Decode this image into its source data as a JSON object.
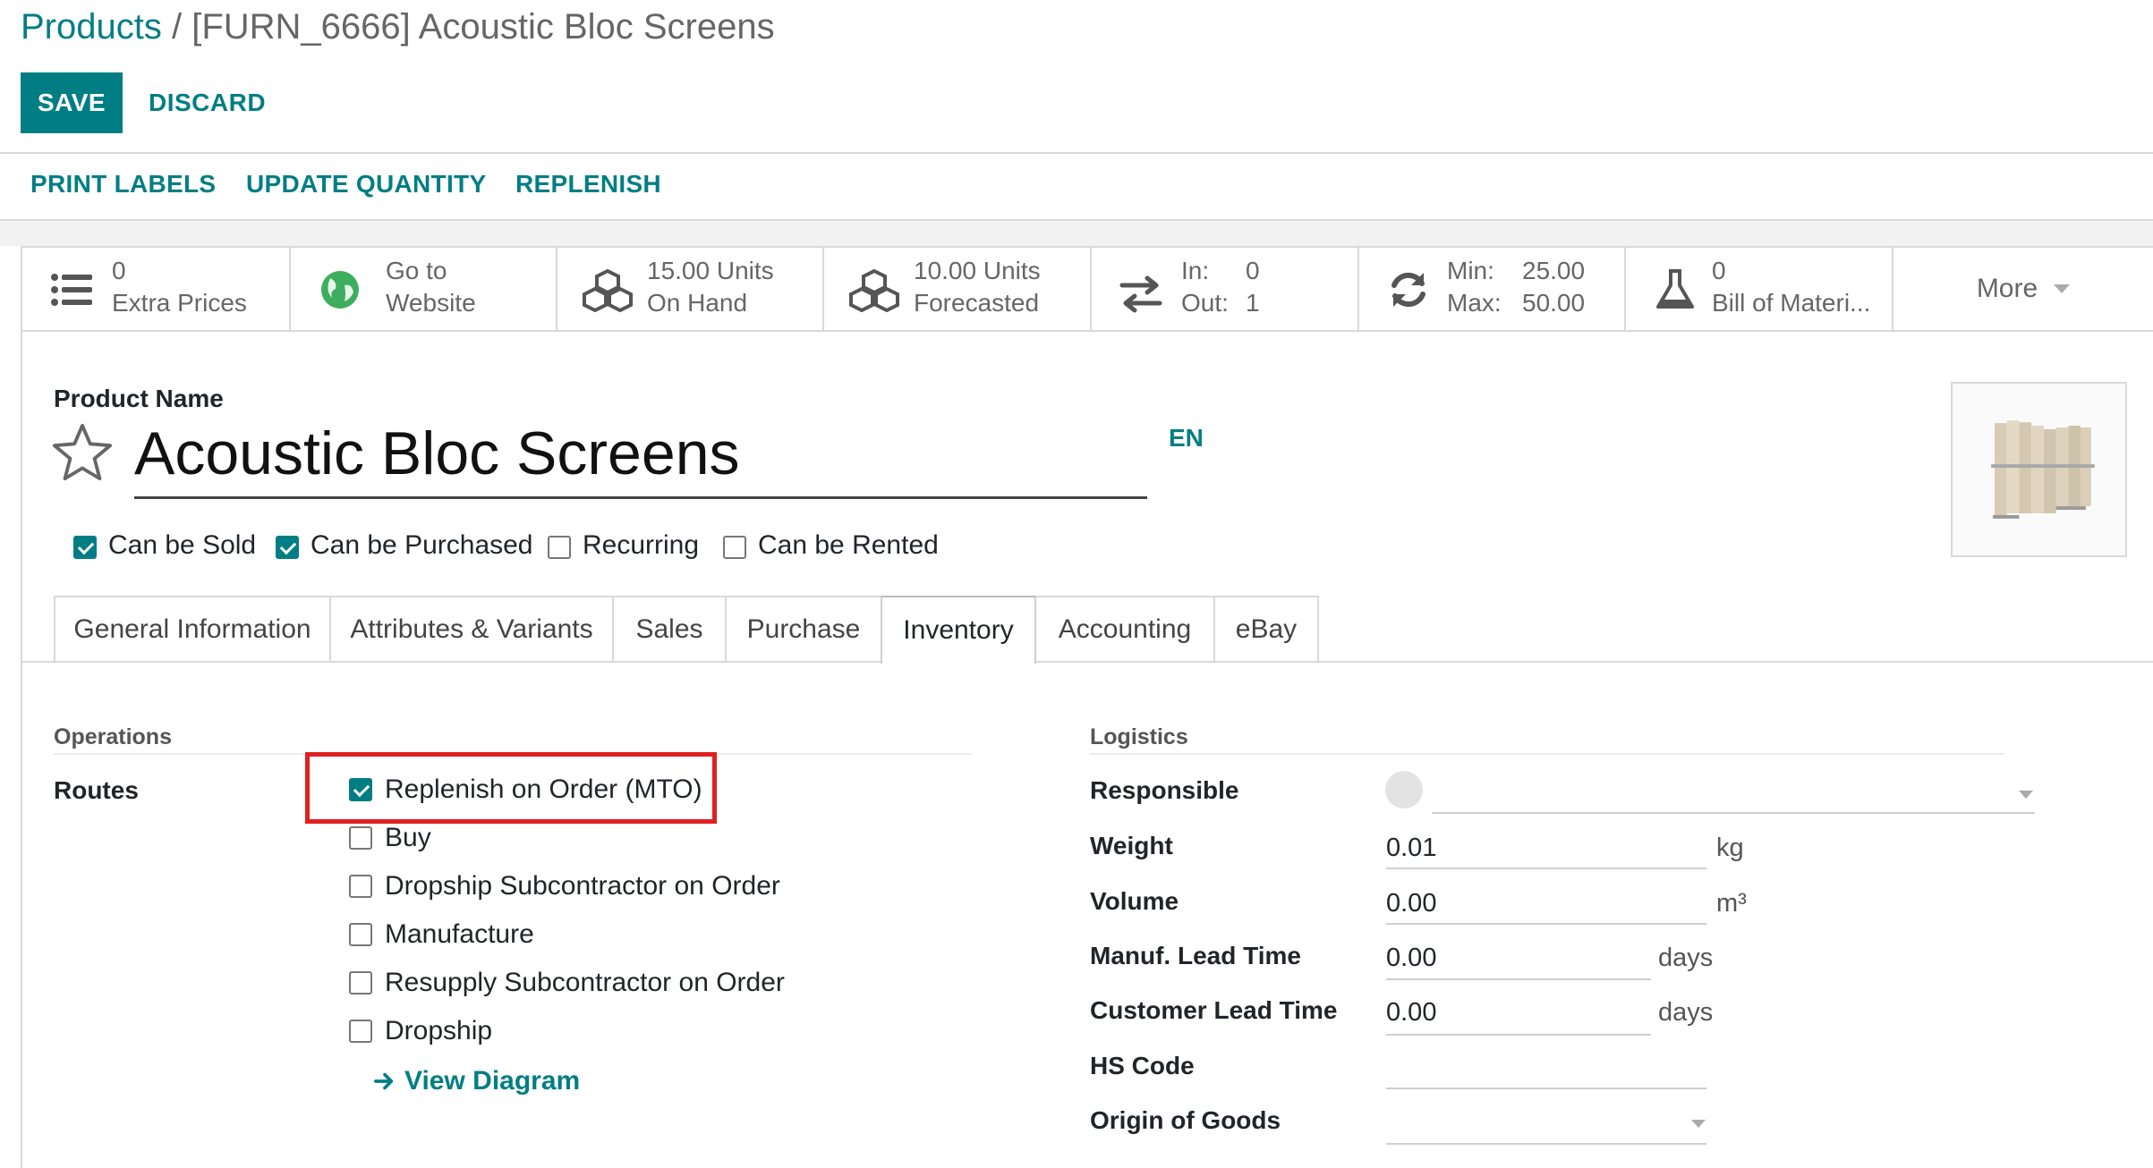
{
  "breadcrumb": {
    "parent": "Products",
    "separator": " / ",
    "current": "[FURN_6666] Acoustic Bloc Screens"
  },
  "buttons": {
    "save": "SAVE",
    "discard": "DISCARD"
  },
  "actions": {
    "print_labels": "PRINT LABELS",
    "update_quantity": "UPDATE QUANTITY",
    "replenish": "REPLENISH"
  },
  "smart_buttons": {
    "extra_prices": {
      "value": "0",
      "label": "Extra Prices",
      "icon": "list-icon"
    },
    "website": {
      "line1": "Go to",
      "line2": "Website",
      "icon": "globe-icon"
    },
    "on_hand": {
      "line1": "15.00 Units",
      "line2": "On Hand",
      "icon": "cubes-icon"
    },
    "forecasted": {
      "line1": "10.00 Units",
      "line2": "Forecasted",
      "icon": "cubes-icon"
    },
    "in_out": {
      "in_label": "In:",
      "in_value": "0",
      "out_label": "Out:",
      "out_value": "1",
      "icon": "exchange-icon"
    },
    "min_max": {
      "min_label": "Min:",
      "min_value": "25.00",
      "max_label": "Max:",
      "max_value": "50.00",
      "icon": "refresh-icon"
    },
    "bom": {
      "value": "0",
      "label": "Bill of Materi...",
      "icon": "flask-icon"
    },
    "more": "More"
  },
  "product": {
    "name_label": "Product Name",
    "name": "Acoustic Bloc Screens",
    "lang": "EN",
    "checkboxes": [
      {
        "label": "Can be Sold",
        "checked": true
      },
      {
        "label": "Can be Purchased",
        "checked": true
      },
      {
        "label": "Recurring",
        "checked": false
      },
      {
        "label": "Can be Rented",
        "checked": false
      }
    ]
  },
  "tabs": [
    {
      "label": "General Information"
    },
    {
      "label": "Attributes & Variants"
    },
    {
      "label": "Sales"
    },
    {
      "label": "Purchase"
    },
    {
      "label": "Inventory",
      "active": true
    },
    {
      "label": "Accounting"
    },
    {
      "label": "eBay"
    }
  ],
  "operations": {
    "title": "Operations",
    "routes_label": "Routes",
    "routes": [
      {
        "label": "Replenish on Order (MTO)",
        "checked": true
      },
      {
        "label": "Buy",
        "checked": false
      },
      {
        "label": "Dropship Subcontractor on Order",
        "checked": false
      },
      {
        "label": "Manufacture",
        "checked": false
      },
      {
        "label": "Resupply Subcontractor on Order",
        "checked": false
      },
      {
        "label": "Dropship",
        "checked": false
      }
    ],
    "view_diagram": "View Diagram"
  },
  "logistics": {
    "title": "Logistics",
    "responsible": {
      "label": "Responsible",
      "value": ""
    },
    "weight": {
      "label": "Weight",
      "value": "0.01",
      "unit": "kg"
    },
    "volume": {
      "label": "Volume",
      "value": "0.00",
      "unit": "m³"
    },
    "manuf_lead": {
      "label": "Manuf. Lead Time",
      "value": "0.00",
      "unit": "days"
    },
    "customer_lead": {
      "label": "Customer Lead Time",
      "value": "0.00",
      "unit": "days"
    },
    "hs_code": {
      "label": "HS Code",
      "value": ""
    },
    "origin": {
      "label": "Origin of Goods",
      "value": ""
    }
  },
  "colors": {
    "primary": "#017e84",
    "highlight": "#e02020"
  }
}
